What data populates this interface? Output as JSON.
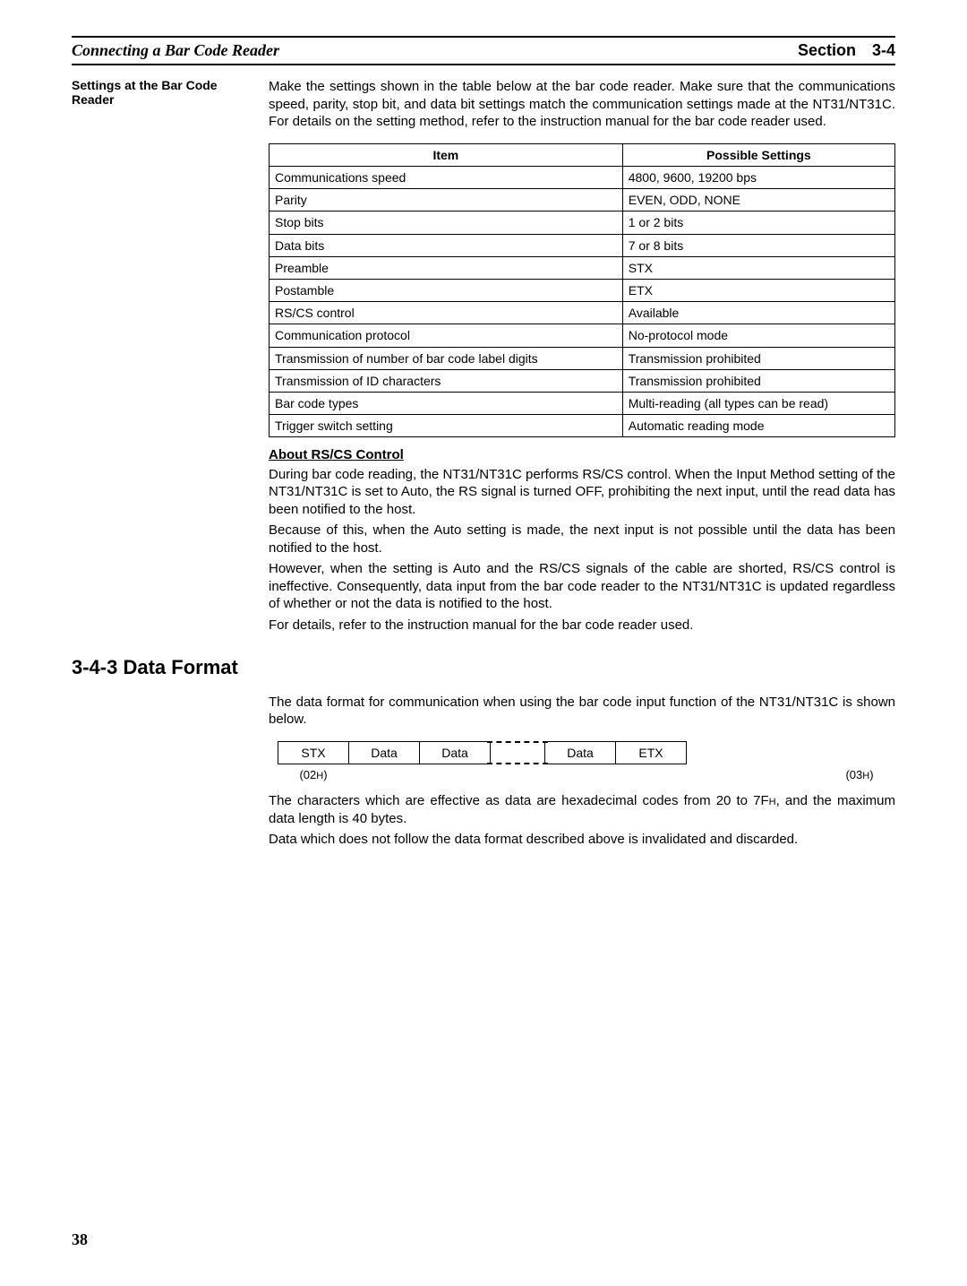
{
  "header": {
    "title": "Connecting a Bar Code Reader",
    "section_label": "Section",
    "section_num": "3-4"
  },
  "sidebar_label": "Settings at the Bar Code Reader",
  "intro_para": "Make the settings shown in the table below at the bar code reader. Make sure that the communications speed, parity, stop bit, and data bit settings match the communication settings made at the NT31/NT31C. For details on the setting method, refer to the instruction manual for the bar code reader used.",
  "table": {
    "header_item": "Item",
    "header_settings": "Possible Settings",
    "rows": [
      {
        "item": "Communications speed",
        "val": "4800, 9600, 19200 bps"
      },
      {
        "item": "Parity",
        "val": "EVEN, ODD, NONE"
      },
      {
        "item": "Stop bits",
        "val": "1 or 2 bits"
      },
      {
        "item": "Data bits",
        "val": "7 or 8 bits"
      },
      {
        "item": "Preamble",
        "val": "STX"
      },
      {
        "item": "Postamble",
        "val": "ETX"
      },
      {
        "item": "RS/CS control",
        "val": "Available"
      },
      {
        "item": "Communication protocol",
        "val": "No-protocol mode"
      },
      {
        "item": "Transmission of number of bar code label digits",
        "val": "Transmission prohibited"
      },
      {
        "item": "Transmission of ID characters",
        "val": "Transmission prohibited"
      },
      {
        "item": "Bar code types",
        "val": "Multi-reading (all types can be read)"
      },
      {
        "item": "Trigger switch setting",
        "val": "Automatic reading mode"
      }
    ]
  },
  "about_heading": "About RS/CS Control",
  "about_p1": "During bar code reading, the NT31/NT31C performs RS/CS control. When the Input Method setting of the NT31/NT31C is set to Auto, the RS signal is turned OFF, prohibiting the next input, until the read data has been notified to the host.",
  "about_p2": "Because of this, when the Auto setting is made, the next input is not possible until the data has been notified to the host.",
  "about_p3": "However, when the setting is Auto and the RS/CS signals of the cable are shorted, RS/CS control is ineffective. Consequently, data input from the bar code reader to the NT31/NT31C is updated regardless of whether or not the data is notified to the host.",
  "about_p4": "For details, refer to the instruction manual for the bar code reader used.",
  "section_heading": "3-4-3   Data Format",
  "df_intro": "The data format for communication when using the bar code input function of the NT31/NT31C is shown below.",
  "df": {
    "stx": "STX",
    "data": "Data",
    "etx": "ETX",
    "hex_stx": "(02",
    "hex_etx": "(03",
    "hex_h": "H",
    "hex_close": ")"
  },
  "df_p1a": "The characters which are effective as data are hexadecimal codes from 20 to 7F",
  "df_p1b": ", and the maximum data length is 40 bytes.",
  "df_p1h": "H",
  "df_p2": "Data which does not follow the data format described above is invalidated and discarded.",
  "page_num": "38"
}
